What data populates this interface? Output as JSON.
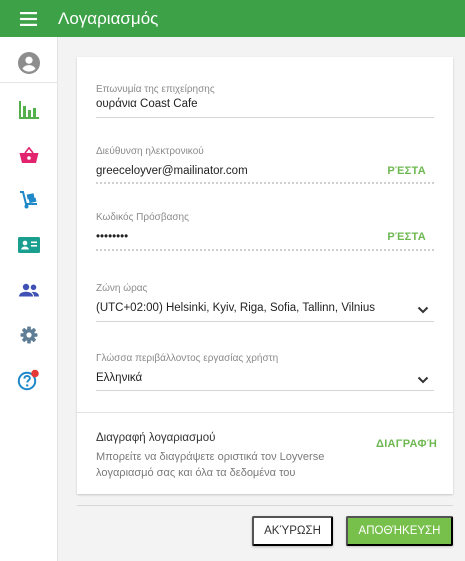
{
  "header": {
    "title": "Λογαριασμός"
  },
  "colors": {
    "brand": "#3da148",
    "accent_link": "#6eb852",
    "save_button": "#78c04c",
    "notification_dot": "#e53935"
  },
  "sidebar": {
    "items": [
      {
        "name": "account",
        "icon": "account-circle-icon"
      },
      {
        "name": "reports",
        "icon": "bar-chart-icon"
      },
      {
        "name": "sales",
        "icon": "basket-icon"
      },
      {
        "name": "inventory",
        "icon": "hand-truck-icon"
      },
      {
        "name": "employees",
        "icon": "id-card-icon"
      },
      {
        "name": "customers",
        "icon": "people-icon"
      },
      {
        "name": "settings",
        "icon": "gear-icon"
      },
      {
        "name": "help",
        "icon": "help-circle-icon",
        "has_badge": true
      }
    ]
  },
  "form": {
    "business_name": {
      "label": "Επωνυμία της επιχείρησης",
      "value": "ουράνια Coast Cafe"
    },
    "email": {
      "label": "Διεύθυνση ηλεκτρονικού",
      "value": "greeceloyver@mailinator.com",
      "action": "ΡΈΣΤΑ"
    },
    "password": {
      "label": "Κωδικός Πρόσβασης",
      "value": "••••••••",
      "action": "ΡΈΣΤΑ"
    },
    "timezone": {
      "label": "Ζώνη ώρας",
      "value": "(UTC+02:00) Helsinki, Kyiv, Riga, Sofia, Tallinn, Vilnius"
    },
    "language": {
      "label": "Γλώσσα περιβάλλοντος εργασίας χρήστη",
      "value": "Ελληνικά"
    }
  },
  "delete_account": {
    "title": "Διαγραφή λογαριασμού",
    "description": "Μπορείτε να διαγράψετε οριστικά τον Loyverse λογαριασμό σας και όλα τα δεδομένα του",
    "action": "ΔΙΑΓΡΑΦΉ"
  },
  "buttons": {
    "cancel": "ΑΚΎΡΩΣΗ",
    "save": "ΑΠΟΘΉΚΕΥΣΗ"
  }
}
